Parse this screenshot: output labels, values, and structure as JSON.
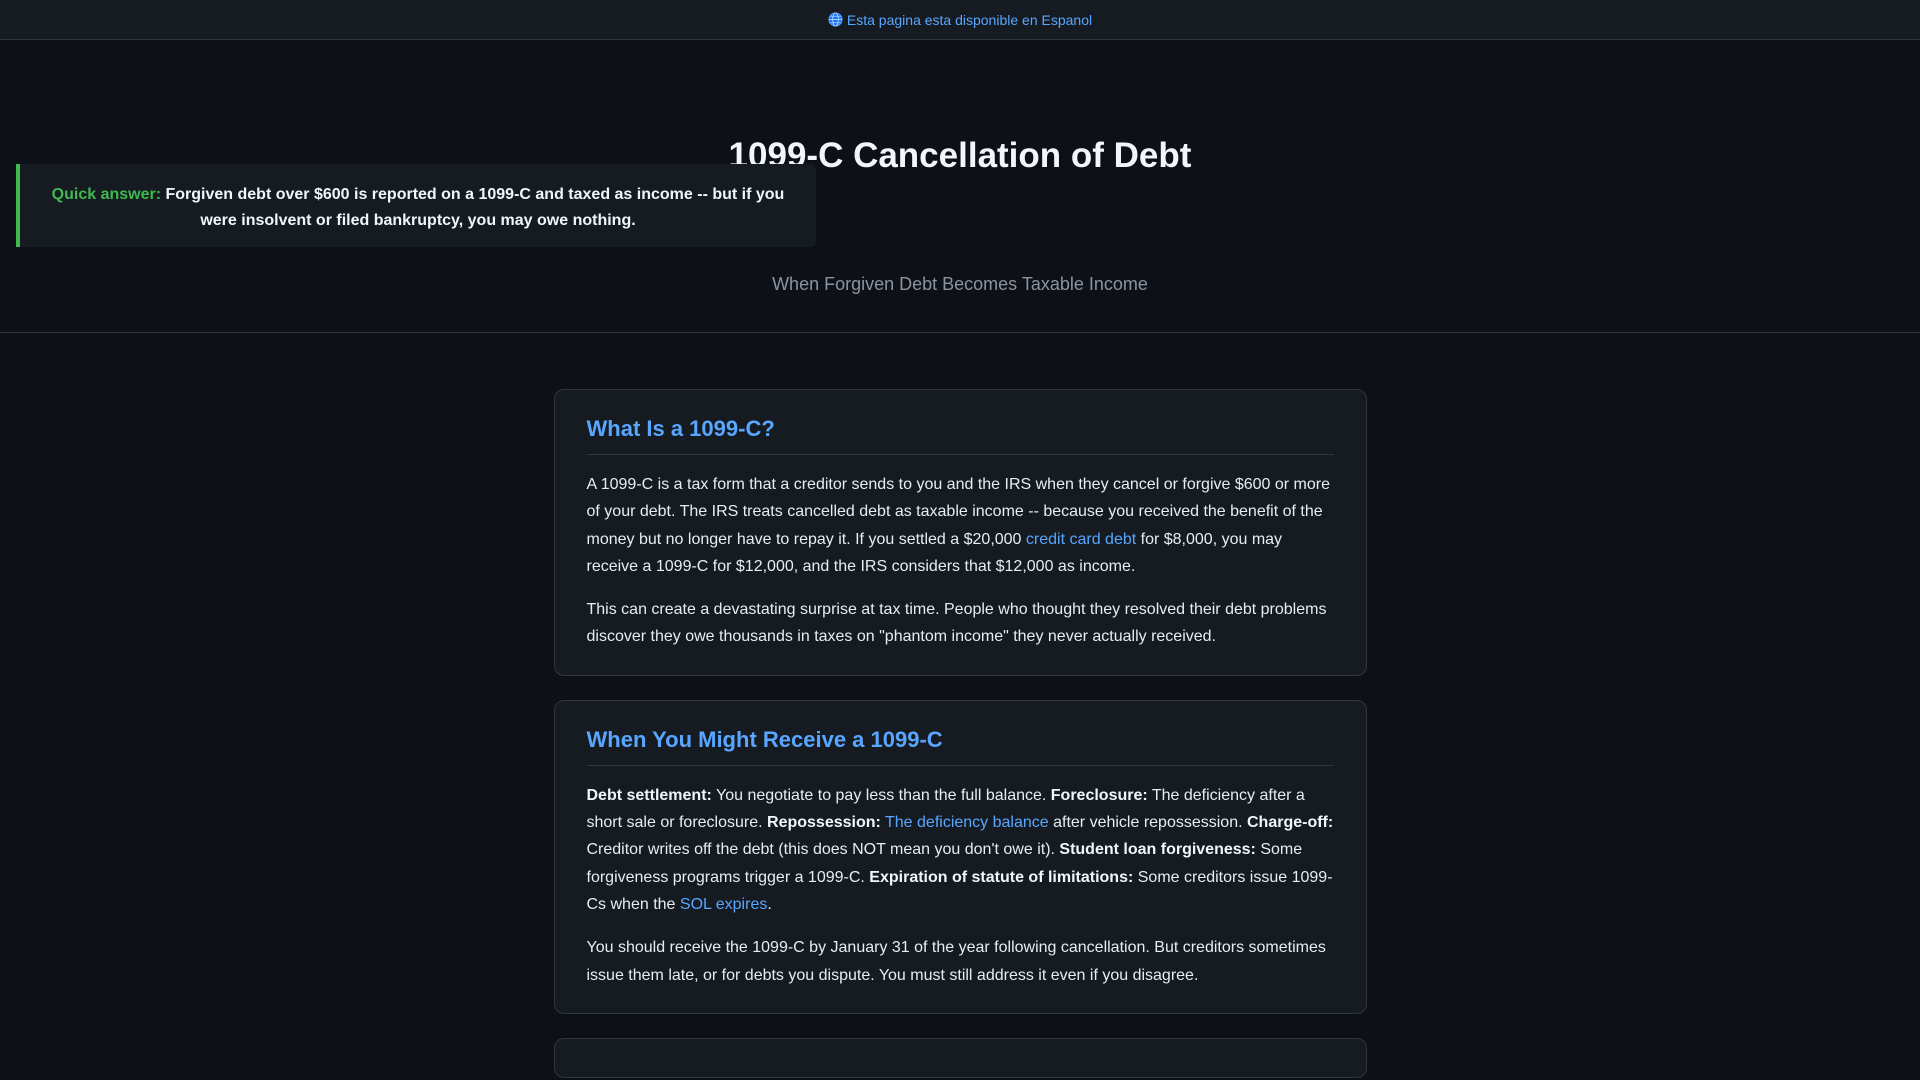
{
  "lang_bar": {
    "icon": "globe-icon",
    "text": "Esta pagina esta disponible en Espanol"
  },
  "header": {
    "title": "1099-C Cancellation of Debt",
    "quick_answer": {
      "label": "Quick answer:",
      "text": "Forgiven debt over $600 is reported on a 1099-C and taxed as income -- but if you were insolvent or filed bankruptcy, you may owe nothing."
    },
    "subtitle": "When Forgiven Debt Becomes Taxable Income"
  },
  "sections": {
    "what_is": {
      "heading": "What Is a 1099-C?",
      "p1_a": "A 1099-C is a tax form that a creditor sends to you and the IRS when they cancel or forgive $600 or more of your debt. The IRS treats cancelled debt as taxable income -- because you received the benefit of the money but no longer have to repay it. If you settled a $20,000 ",
      "p1_link": "credit card debt",
      "p1_b": " for $8,000, you may receive a 1099-C for $12,000, and the IRS considers that $12,000 as income.",
      "p2": "This can create a devastating surprise at tax time. People who thought they resolved their debt problems discover they owe thousands in taxes on \"phantom income\" they never actually received."
    },
    "when_receive": {
      "heading": "When You Might Receive a 1099-C",
      "settlement_label": "Debt settlement:",
      "settlement_text": " You negotiate to pay less than the full balance. ",
      "foreclosure_label": "Foreclosure:",
      "foreclosure_text": " The deficiency after a short sale or foreclosure. ",
      "repossession_label": "Repossession:",
      "repossession_link": "The deficiency balance",
      "repossession_text": " after vehicle repossession. ",
      "chargeoff_label": "Charge-off:",
      "chargeoff_text": " Creditor writes off the debt (this does NOT mean you don't owe it). ",
      "student_label": "Student loan forgiveness:",
      "student_text": " Some forgiveness programs trigger a 1099-C. ",
      "sol_label": "Expiration of statute of limitations:",
      "sol_text": " Some creditors issue 1099-Cs when the ",
      "sol_link": "SOL expires",
      "sol_end": ".",
      "p2": "You should receive the 1099-C by January 31 of the year following cancellation. But creditors sometimes issue them late, or for debts you dispute. You must still address it even if you disagree."
    }
  }
}
